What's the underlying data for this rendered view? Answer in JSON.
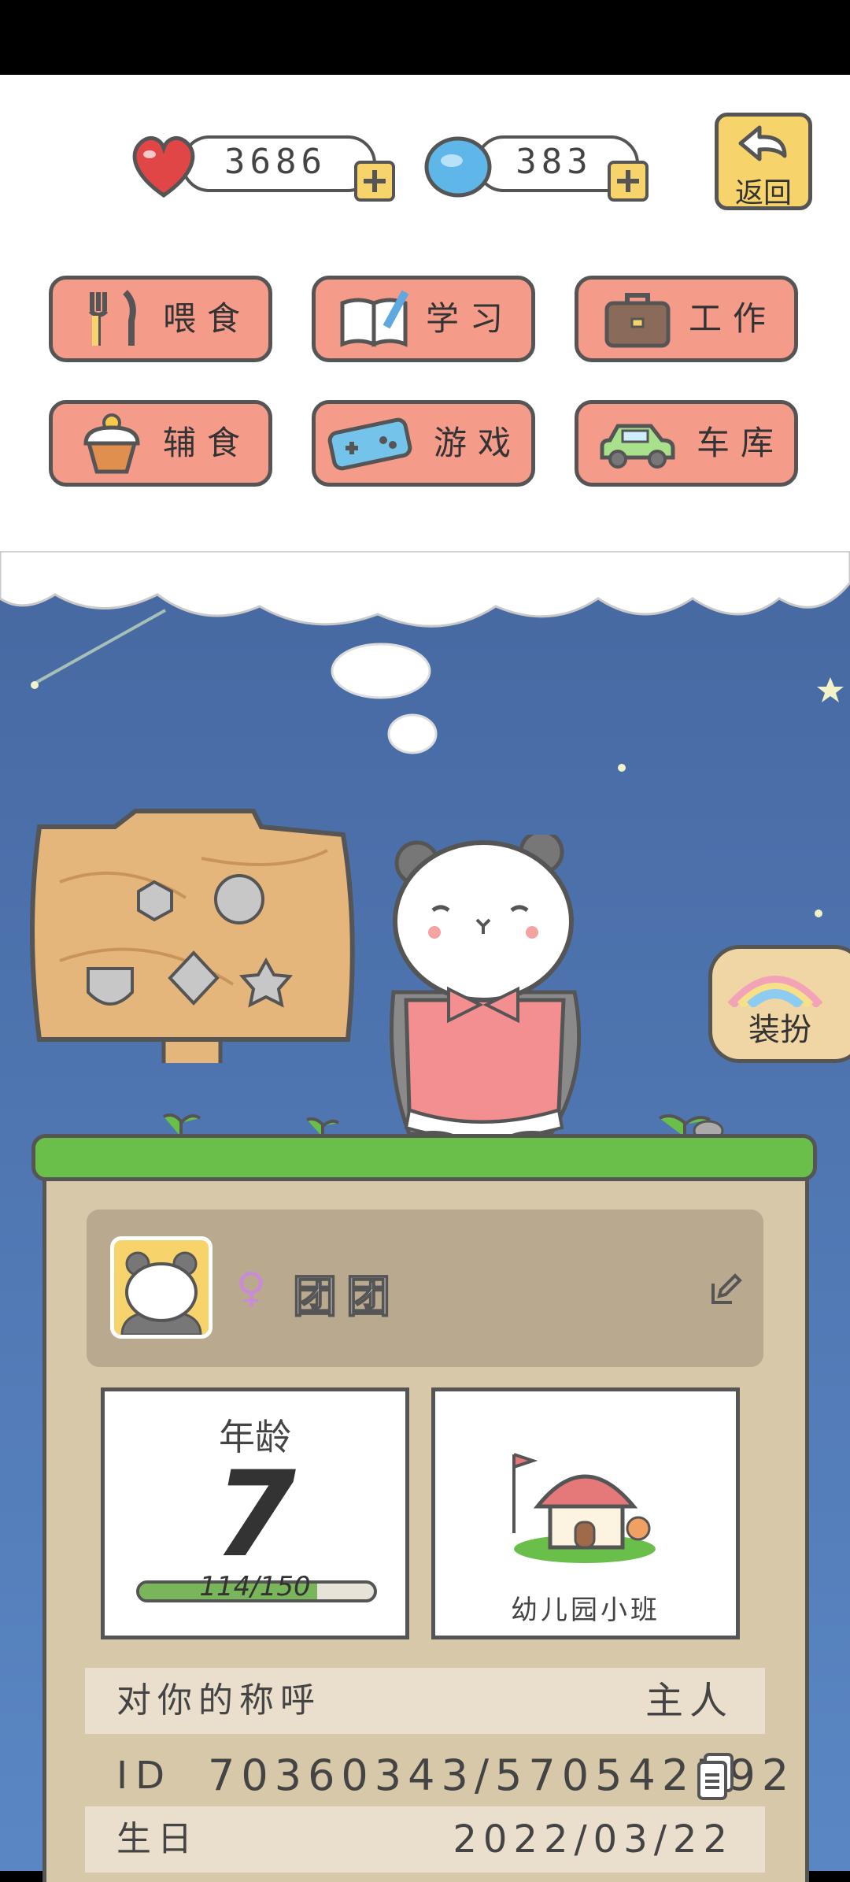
{
  "currencies": {
    "hearts": "3686",
    "coins": "383"
  },
  "back_label": "返回",
  "menu": [
    {
      "label": "喂食",
      "icon": "fork-knife-icon"
    },
    {
      "label": "学习",
      "icon": "book-pencil-icon"
    },
    {
      "label": "工作",
      "icon": "briefcase-icon"
    },
    {
      "label": "辅食",
      "icon": "cupcake-icon"
    },
    {
      "label": "游戏",
      "icon": "gamepad-icon"
    },
    {
      "label": "车库",
      "icon": "car-icon"
    }
  ],
  "dressup_label": "装扮",
  "pet": {
    "gender_symbol": "♀",
    "name": "团团"
  },
  "age": {
    "label": "年龄",
    "value": "7",
    "progress": "114/150",
    "progress_fraction": 0.76
  },
  "school": {
    "label": "幼儿园小班"
  },
  "info": {
    "nickname_label": "对你的称呼",
    "nickname_value": "主人",
    "id_label": "ID",
    "id_value": "70360343/570542592",
    "birthday_label": "生日",
    "birthday_value": "2022/03/22"
  },
  "colors": {
    "menu_button": "#f59b8a",
    "accent_yellow": "#f6d46b",
    "grass": "#6abf4b",
    "sky": "#4a6ea8"
  }
}
